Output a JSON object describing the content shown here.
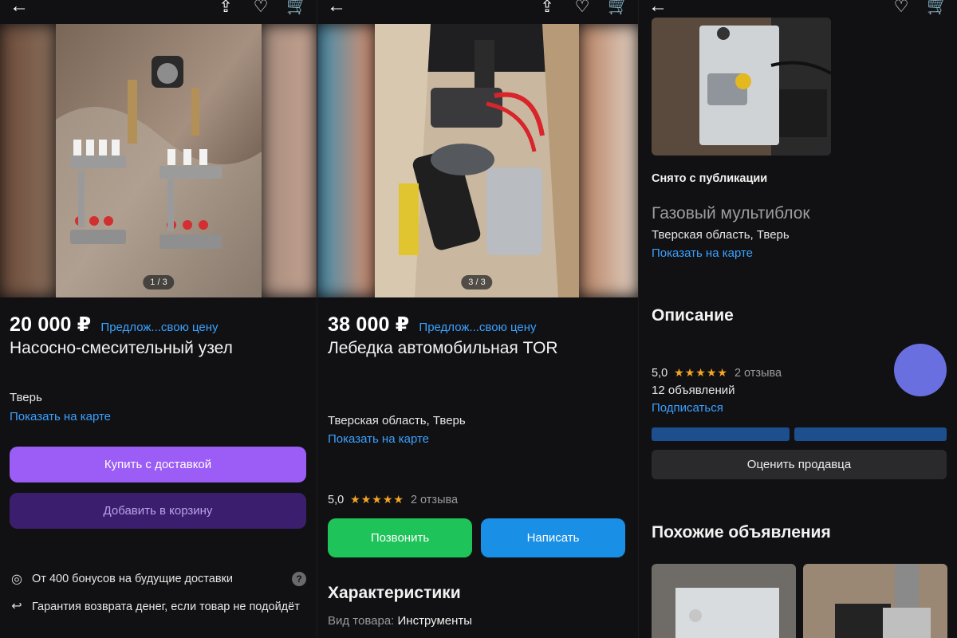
{
  "screens": [
    {
      "photo_counter": "1 / 3",
      "price": "20 000 ₽",
      "offer_link": "Предлож...свою цену",
      "title": "Насосно-смесительный узел",
      "location": "Тверь",
      "map_link": "Показать на карте",
      "buy_button": "Купить с доставкой",
      "cart_button": "Добавить в корзину",
      "bonus_text": "От 400 бонусов на будущие доставки",
      "bonus_help": "?",
      "guarantee_text": "Гарантия возврата денег, если товар не подойдёт"
    },
    {
      "photo_counter": "3 / 3",
      "price": "38 000 ₽",
      "offer_link": "Предлож...свою цену",
      "title": "Лебедка автомобильная TOR",
      "location": "Тверская область, Тверь",
      "map_link": "Показать на карте",
      "rating": "5,0",
      "stars": "★★★★★",
      "reviews": "2 отзыва",
      "call_button": "Позвонить",
      "write_button": "Написать",
      "specs_heading": "Характеристики",
      "spec_label": "Вид товара:",
      "spec_value": "Инструменты"
    },
    {
      "status": "Снято с публикации",
      "title": "Газовый мультиблок",
      "location": "Тверская область, Тверь",
      "map_link": "Показать на карте",
      "description_heading": "Описание",
      "rating": "5,0",
      "stars": "★★★★★",
      "reviews": "2 отзыва",
      "listings_count": "12 объявлений",
      "subscribe_link": "Подписаться",
      "rate_seller_button": "Оценить продавца",
      "similar_heading": "Похожие объявления"
    }
  ],
  "icons": {
    "back": "←",
    "share": "⇪",
    "favorite": "♡",
    "cart": "🛒"
  },
  "colors": {
    "background": "#111113",
    "link": "#3aa1ff",
    "buy": "#9c5cf6",
    "cart": "#3b1f6e",
    "call": "#1ec45a",
    "write": "#1a8fe6",
    "star": "#f5a623"
  }
}
